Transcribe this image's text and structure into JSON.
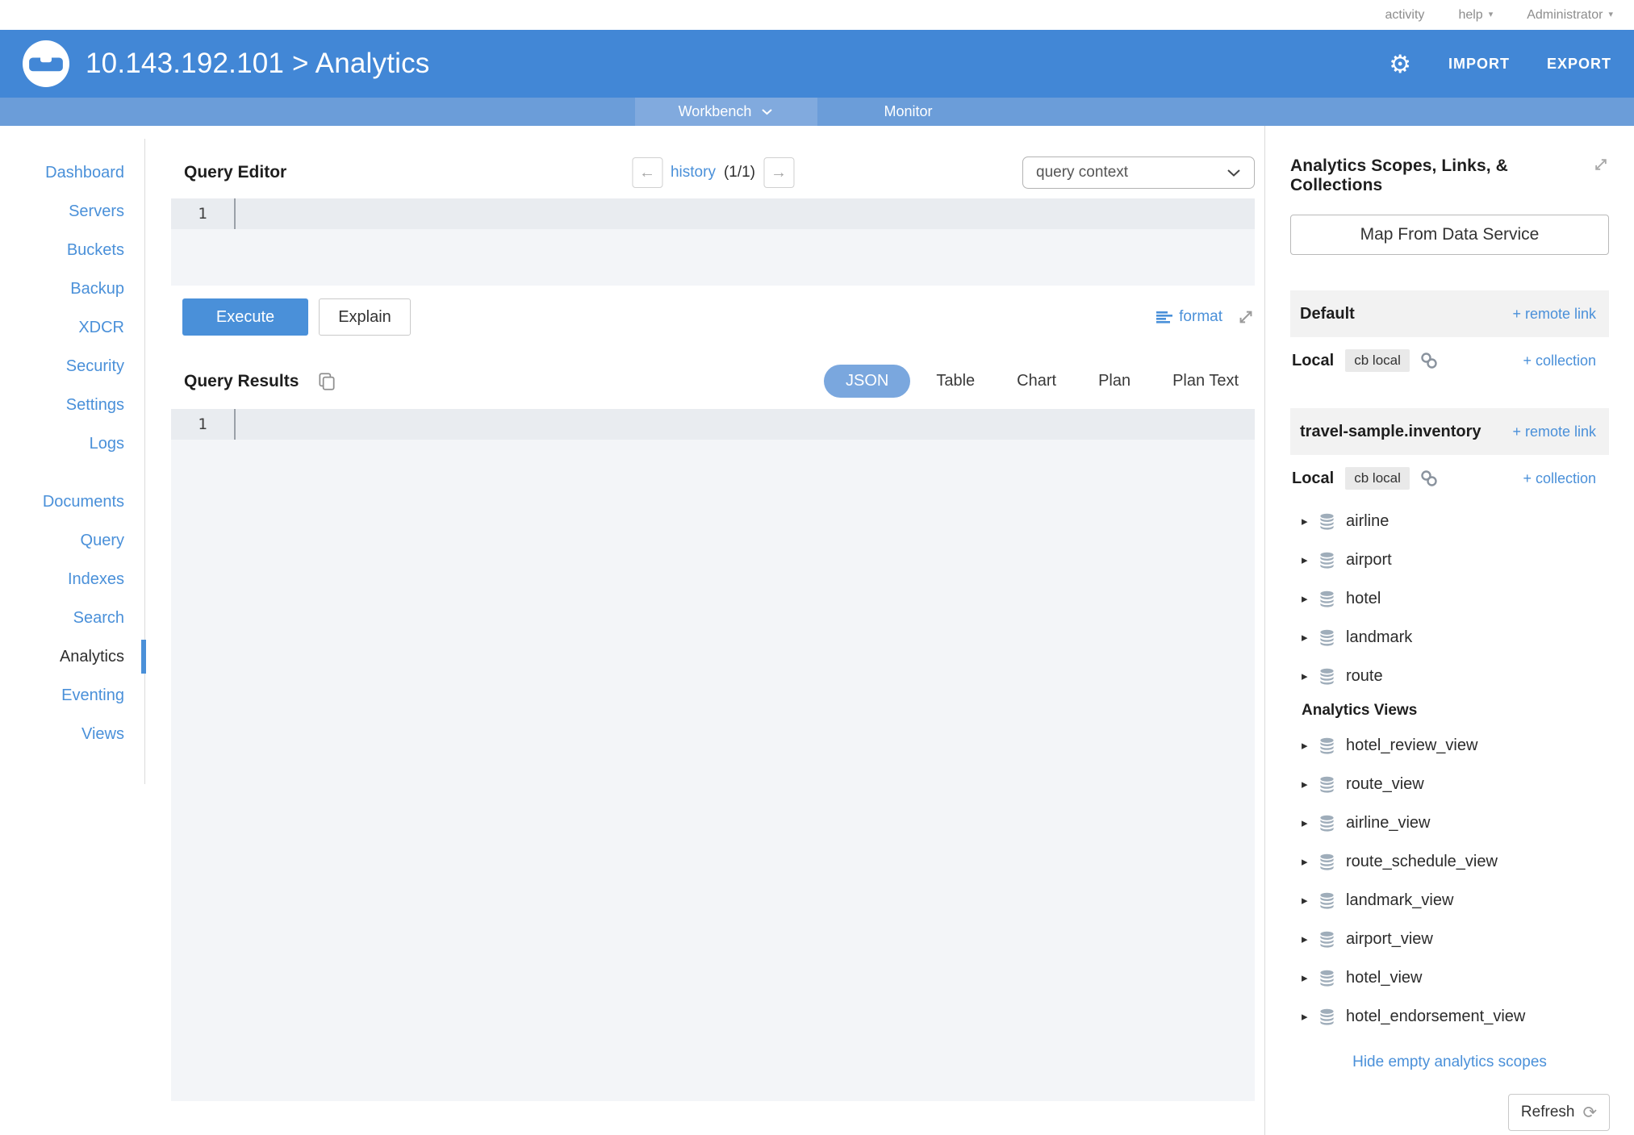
{
  "colors": {
    "header_blue": "#4287d6",
    "band_blue": "#6b9dd9",
    "active_tab_blue": "#81aade",
    "link_blue": "#4a90d9",
    "json_pill_blue": "#7aa7de",
    "editor_line_bg": "#e9ecf0",
    "editor_body_bg": "#f3f5f8"
  },
  "topbar": {
    "activity": "activity",
    "help": "help",
    "administrator": "Administrator"
  },
  "header": {
    "title": "10.143.192.101 > Analytics",
    "import_label": "IMPORT",
    "export_label": "EXPORT"
  },
  "nav": {
    "workbench": "Workbench",
    "monitor": "Monitor"
  },
  "sidebar": {
    "group1": [
      "Dashboard",
      "Servers",
      "Buckets",
      "Backup",
      "XDCR",
      "Security",
      "Settings",
      "Logs"
    ],
    "group2": [
      "Documents",
      "Query",
      "Indexes",
      "Search",
      "Analytics",
      "Eventing",
      "Views"
    ],
    "active_item": "Analytics"
  },
  "query_editor": {
    "title": "Query Editor",
    "history_label": "history",
    "history_count": "(1/1)",
    "context_value": "query context",
    "line_number": "1",
    "execute_label": "Execute",
    "explain_label": "Explain",
    "format_label": "format"
  },
  "query_results": {
    "title": "Query Results",
    "tabs": [
      "JSON",
      "Table",
      "Chart",
      "Plan",
      "Plan Text"
    ],
    "active_tab": "JSON",
    "line_number": "1"
  },
  "panel": {
    "title": "Analytics Scopes, Links, & Collections",
    "map_button_label": "Map From Data Service",
    "remote_link_label": "+ remote link",
    "collection_link_label": "+ collection",
    "local_label": "Local",
    "local_badge": "cb local",
    "scopes": [
      {
        "name": "Default"
      },
      {
        "name": "travel-sample.inventory"
      }
    ],
    "collections": [
      "airline",
      "airport",
      "hotel",
      "landmark",
      "route"
    ],
    "views_header": "Analytics Views",
    "views": [
      "hotel_review_view",
      "route_view",
      "airline_view",
      "route_schedule_view",
      "landmark_view",
      "airport_view",
      "hotel_view",
      "hotel_endorsement_view"
    ],
    "hide_link": "Hide empty analytics scopes",
    "refresh_label": "Refresh"
  },
  "icons": {
    "gear": "⚙",
    "caret_down": "▾",
    "arrow_left": "←",
    "arrow_right": "→",
    "expander": "▸",
    "refresh": "⟳"
  }
}
